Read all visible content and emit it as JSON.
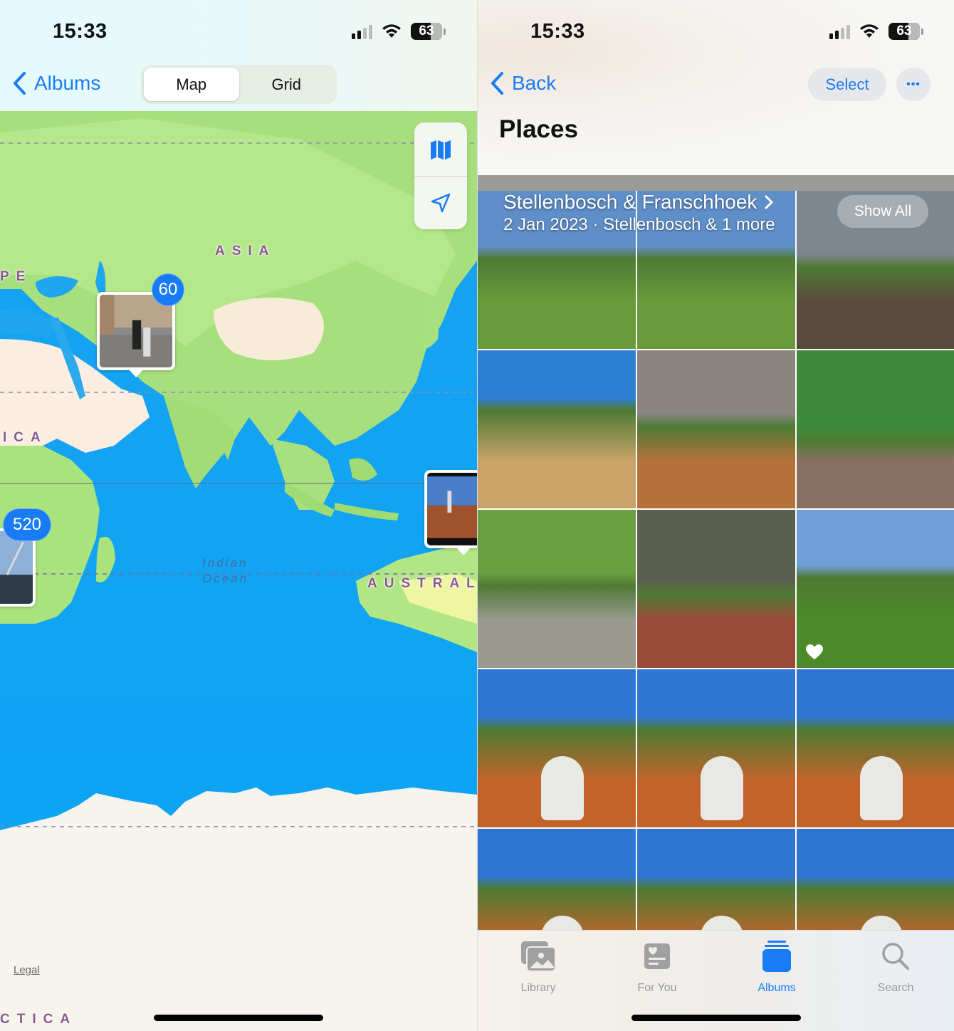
{
  "left": {
    "status": {
      "time": "15:33",
      "battery": "63"
    },
    "nav": {
      "back_label": "Albums"
    },
    "segmented": [
      {
        "label": "Map",
        "active": true
      },
      {
        "label": "Grid",
        "active": false
      }
    ],
    "map": {
      "region_labels": {
        "asia": "ASIA",
        "europe": "PE",
        "africa": "ICA",
        "australia": "AUSTRALI",
        "antarctica": "CTICA"
      },
      "ocean_label_line1": "Indian",
      "ocean_label_line2": "Ocean",
      "pins": [
        {
          "count": "60",
          "location": "Middle East"
        },
        {
          "count": "520",
          "location": "Cape Town"
        },
        {
          "count": "",
          "location": "Australia"
        }
      ],
      "controls": {
        "map_mode_icon": "map-icon",
        "location_icon": "location-arrow-icon"
      },
      "legal_label": "Legal"
    },
    "colors": {
      "accent": "#1a7cf5",
      "land": "#b8e986",
      "ocean": "#0ea5f0",
      "desert": "#fbeee0",
      "ice": "#f6f4ec",
      "label": "#8a5a8c"
    }
  },
  "right": {
    "status": {
      "time": "15:33",
      "battery": "63"
    },
    "nav": {
      "back_label": "Back",
      "select_label": "Select",
      "more_label": "•••"
    },
    "title": "Places",
    "section": {
      "title": "Stellenbosch & Franschhoek",
      "subtitle": "2 Jan 2023  ·  Stellenbosch & 1 more",
      "show_all_label": "Show All"
    },
    "photos": [
      {
        "subject": "vineyard rows",
        "favorite": false
      },
      {
        "subject": "vineyard rows",
        "favorite": false
      },
      {
        "subject": "bronze animal sculptures",
        "favorite": false
      },
      {
        "subject": "vineyard hill path",
        "favorite": false
      },
      {
        "subject": "bread counter",
        "favorite": false
      },
      {
        "subject": "twisted sculpture",
        "favorite": false
      },
      {
        "subject": "white dog sculpture",
        "favorite": false
      },
      {
        "subject": "red animal sculpture",
        "favorite": false
      },
      {
        "subject": "stone head sculpture",
        "favorite": true
      },
      {
        "subject": "white figures path",
        "favorite": false
      },
      {
        "subject": "white figures path",
        "favorite": false
      },
      {
        "subject": "white figures path",
        "favorite": false
      },
      {
        "subject": "white figures path",
        "favorite": false
      },
      {
        "subject": "white figures path",
        "favorite": false
      },
      {
        "subject": "white figures path",
        "favorite": false
      }
    ],
    "tabs": [
      {
        "label": "Library",
        "icon": "photo-library-icon",
        "active": false
      },
      {
        "label": "For You",
        "icon": "for-you-icon",
        "active": false
      },
      {
        "label": "Albums",
        "icon": "albums-icon",
        "active": true
      },
      {
        "label": "Search",
        "icon": "search-icon",
        "active": false
      }
    ]
  }
}
